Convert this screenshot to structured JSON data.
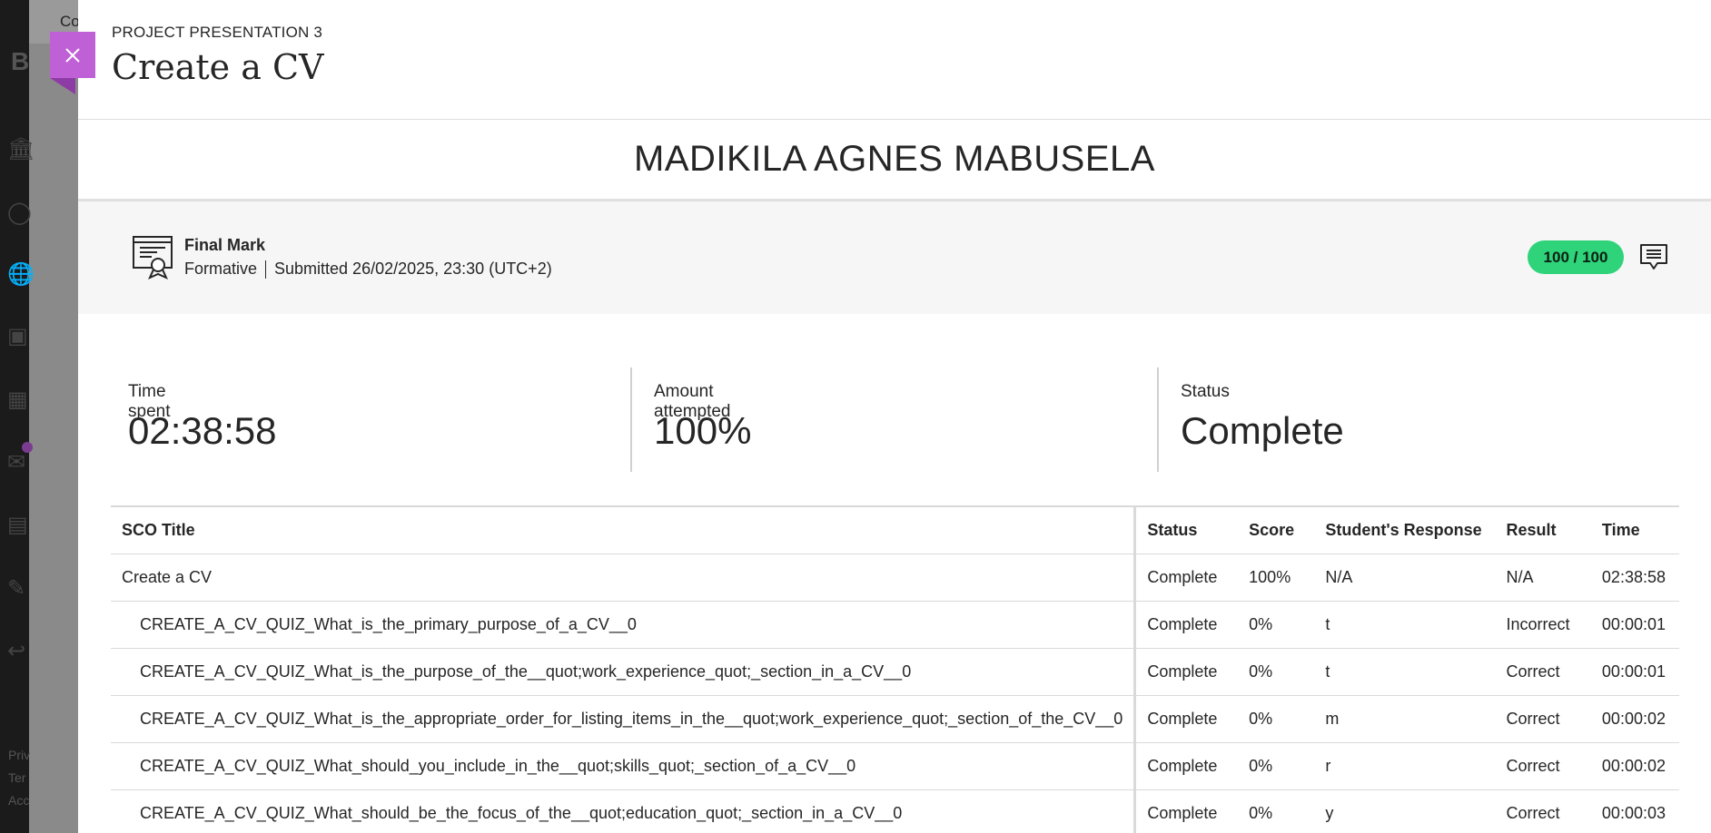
{
  "background": {
    "top_text": "Co",
    "logo_text": "B",
    "footer_lines": [
      "Priv",
      "Ter",
      "Acc"
    ]
  },
  "close_button": {
    "icon": "close-icon",
    "color": "#c060d6"
  },
  "header": {
    "eyebrow": "PROJECT PRESENTATION 3",
    "title": "Create a CV"
  },
  "student_name": "MADIKILA AGNES MABUSELA",
  "grade": {
    "icon": "certificate-icon",
    "title": "Final Mark",
    "type": "Formative",
    "submitted": "Submitted 26/02/2025, 23:30 (UTC+2)",
    "score": "100 / 100",
    "score_color": "#2ed37a",
    "feedback_icon": "feedback-icon"
  },
  "stats": [
    {
      "label": "Time spent",
      "value": "02:38:58"
    },
    {
      "label": "Amount attempted",
      "value": "100%"
    },
    {
      "label": "Status",
      "value": "Complete"
    }
  ],
  "table": {
    "headers": [
      "SCO Title",
      "Status",
      "Score",
      "Student's Response",
      "Result",
      "Time"
    ],
    "rows": [
      {
        "title": "Create a CV",
        "status": "Complete",
        "score": "100%",
        "response": "N/A",
        "result": "N/A",
        "time": "02:38:58"
      },
      {
        "title": "CREATE_A_CV_QUIZ_What_is_the_primary_purpose_of_a_CV__0",
        "status": "Complete",
        "score": "0%",
        "response": "t",
        "result": "Incorrect",
        "time": "00:00:01"
      },
      {
        "title": "CREATE_A_CV_QUIZ_What_is_the_purpose_of_the__quot;work_experience_quot;_section_in_a_CV__0",
        "status": "Complete",
        "score": "0%",
        "response": "t",
        "result": "Correct",
        "time": "00:00:01"
      },
      {
        "title": "CREATE_A_CV_QUIZ_What_is_the_appropriate_order_for_listing_items_in_the__quot;work_experience_quot;_section_of_the_CV__0",
        "status": "Complete",
        "score": "0%",
        "response": "m",
        "result": "Correct",
        "time": "00:00:02"
      },
      {
        "title": "CREATE_A_CV_QUIZ_What_should_you_include_in_the__quot;skills_quot;_section_of_a_CV__0",
        "status": "Complete",
        "score": "0%",
        "response": "r",
        "result": "Correct",
        "time": "00:00:02"
      },
      {
        "title": "CREATE_A_CV_QUIZ_What_should_be_the_focus_of_the__quot;education_quot;_section_in_a_CV__0",
        "status": "Complete",
        "score": "0%",
        "response": "y",
        "result": "Correct",
        "time": "00:00:03"
      }
    ]
  }
}
